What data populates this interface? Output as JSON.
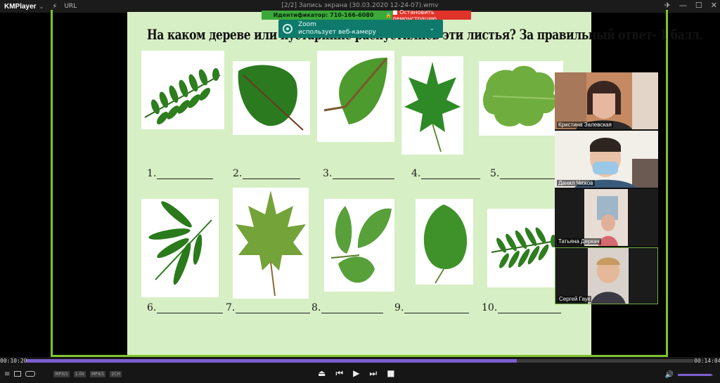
{
  "titlebar": {
    "app_name": "KMPlayer",
    "caret": "⌄",
    "bolt_icon": "⚡",
    "url_label": "URL",
    "window_title": "[2/2] Запись экрана (30.03.2020 12-24-07).wmv",
    "pin": "✈",
    "min": "—",
    "max": "☐",
    "close": "✕"
  },
  "zoom": {
    "meeting_id": "Идентификатор: 710-166-6080",
    "lock": "🔒",
    "stop_label": "■ Остановить демонстрацию",
    "app_label": "Zoom",
    "notification": "использует веб-камеру",
    "caret": "⌄"
  },
  "slide": {
    "title": "На каком дереве или кустарнике распустились эти листья? За правильный ответ- 1 балл.",
    "answers": [
      "1.",
      "2.",
      "3.",
      "4.",
      "5.",
      "6.",
      "7.",
      "8.",
      "9.",
      "10."
    ]
  },
  "participants": [
    {
      "name": "Кристина Залевская"
    },
    {
      "name": "Данил Чижов"
    },
    {
      "name": "Татьяна Деркач"
    },
    {
      "name": "Сергей Гаук"
    }
  ],
  "player": {
    "time_current": "00:10:20",
    "time_total": "00:14:04",
    "progress": 0.735,
    "volume": 0.95,
    "badges": [
      "MP3/1",
      "1.0x",
      "MP4/1",
      "2CH"
    ],
    "icons": {
      "eject": "⏏",
      "prev": "⏮",
      "play": "▶",
      "next": "⏭",
      "stop": "■",
      "speaker": "🔊",
      "menu": "≡"
    }
  },
  "colors": {
    "accent": "#7a5fd0",
    "frame": "#7fc22e",
    "slide_bg": "#d7efc4",
    "zoom_green": "#3aa93a",
    "zoom_red": "#e0332a",
    "zoom_teal": "#0f7a6c"
  }
}
